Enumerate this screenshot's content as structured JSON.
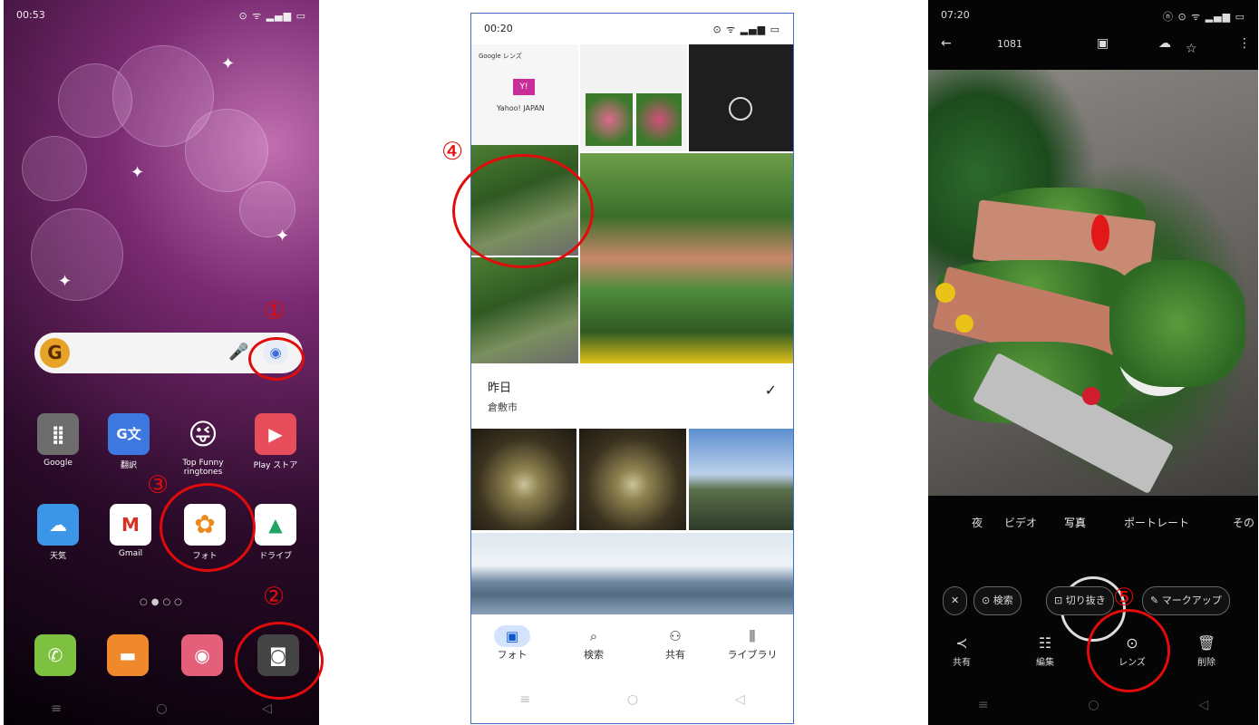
{
  "markers": {
    "m1": "①",
    "m2": "②",
    "m3": "③",
    "m4": "④",
    "m5": "⑤"
  },
  "phone1": {
    "time": "00:53",
    "status_icons": "⊙ ᯤ ▂▄▆ ▭",
    "search": {
      "logo": "G",
      "mic": "🎤",
      "camera": "◉"
    },
    "apps": [
      {
        "label": "Google",
        "glyph": "⣿",
        "color": "#6d6d6d"
      },
      {
        "label": "翻訳",
        "glyph": "G文",
        "color": "#3c78e0"
      },
      {
        "label": "Top Funny\nringtones",
        "glyph": "😜",
        "color": "#f0b53a"
      },
      {
        "label": "Play ストア",
        "glyph": "▶",
        "color": "#e84d5b"
      },
      {
        "label": "天気",
        "glyph": "☁",
        "color": "#3c96e8"
      },
      {
        "label": "Gmail",
        "glyph": "M",
        "color": "#ffffff"
      },
      {
        "label": "フォト",
        "glyph": "✿",
        "color": "#ffffff"
      },
      {
        "label": "ドライブ",
        "glyph": "▲",
        "color": "#ffffff"
      }
    ],
    "dock": [
      {
        "name": "phone",
        "glyph": "✆",
        "color": "#7ec03f"
      },
      {
        "name": "messages",
        "glyph": "▬",
        "color": "#f0882c"
      },
      {
        "name": "browser",
        "glyph": "◉",
        "color": "#e45f79"
      },
      {
        "name": "camera",
        "glyph": "◙",
        "color": "#444444"
      }
    ],
    "nav": [
      "≡",
      "○",
      "◁"
    ]
  },
  "phone2": {
    "time": "00:20",
    "status_icons": "⊙ ᯤ ▂▄▆ ▭",
    "mini": {
      "lens": "Google レンズ",
      "yahoo": "Yahoo! JAPAN"
    },
    "day": "昨日",
    "place": "倉敷市",
    "check": "✓",
    "nav_items": [
      {
        "label": "フォト",
        "icon": "▣"
      },
      {
        "label": "検索",
        "icon": "⌕"
      },
      {
        "label": "共有",
        "icon": "⚇"
      },
      {
        "label": "ライブラリ",
        "icon": "⫼"
      }
    ],
    "nav": [
      "≡",
      "○",
      "◁"
    ]
  },
  "phone3": {
    "time": "07:20",
    "status_icons": "ⓝ ⊙ ᯤ ▂▄▆ ▭",
    "top": {
      "back": "←",
      "count": "1081",
      "cast": "▣",
      "cloud": "☁",
      "star": "☆",
      "menu": "⋮"
    },
    "modes": [
      "夜",
      "ビデオ",
      "写真",
      "ポートレート",
      "その"
    ],
    "chips": {
      "close": "✕",
      "search": "⊙ 検索",
      "crop": "⊡ 切り抜き",
      "markup": "✎ マークアップ"
    },
    "actions": [
      {
        "label": "共有",
        "icon": "≺"
      },
      {
        "label": "編集",
        "icon": "☷"
      },
      {
        "label": "レンズ",
        "icon": "⊙"
      },
      {
        "label": "削除",
        "icon": "🗑"
      }
    ],
    "nav": [
      "≡",
      "○",
      "◁"
    ]
  }
}
